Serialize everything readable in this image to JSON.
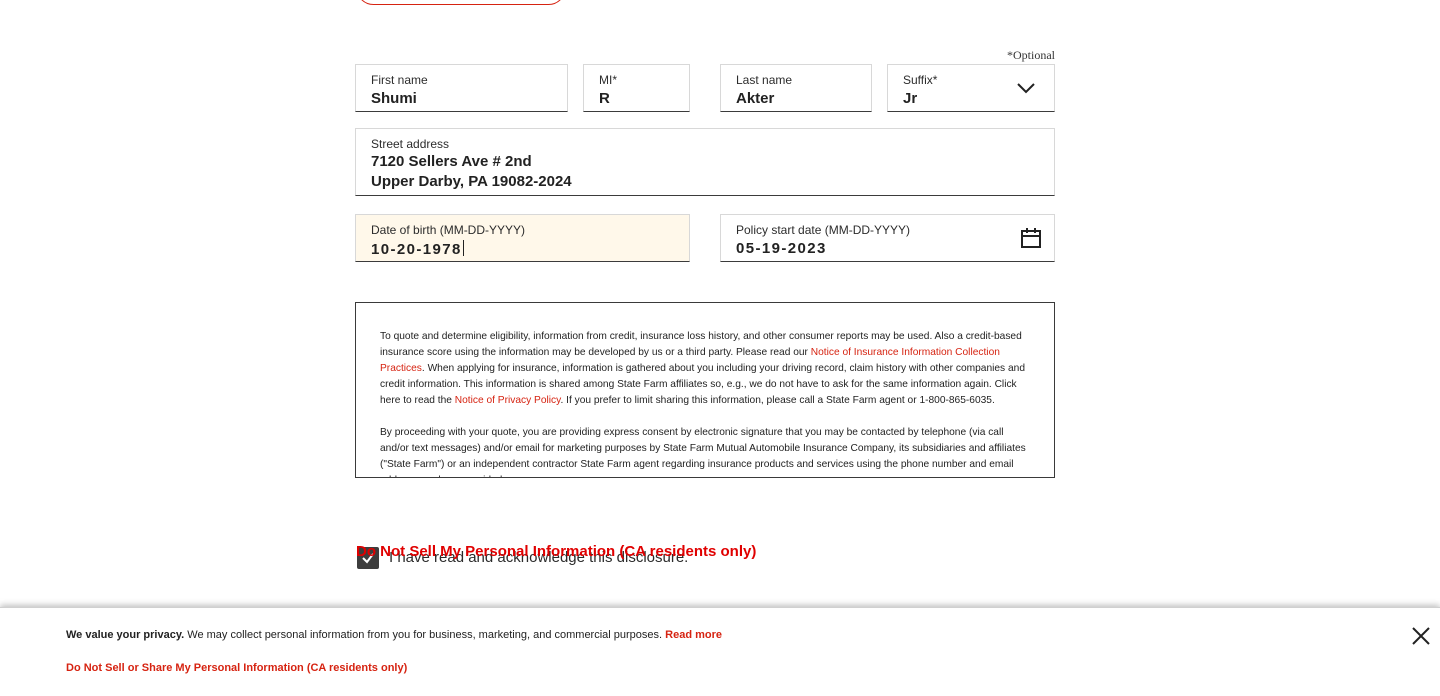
{
  "form": {
    "optional_note": "*Optional",
    "first_name": {
      "label": "First name",
      "value": "Shumi"
    },
    "mi": {
      "label": "MI*",
      "value": "R"
    },
    "last_name": {
      "label": "Last name",
      "value": "Akter"
    },
    "suffix": {
      "label": "Suffix*",
      "value": "Jr"
    },
    "street": {
      "label": "Street address",
      "line1": "7120 Sellers Ave # 2nd",
      "line2": "Upper Darby, PA 19082-2024"
    },
    "dob": {
      "label": "Date of birth (MM-DD-YYYY)",
      "value": "10-20-1978"
    },
    "policy_start": {
      "label": "Policy start date (MM-DD-YYYY)",
      "value": "05-19-2023"
    }
  },
  "disclosure": {
    "p1_a": "To quote and determine eligibility, information from credit, insurance loss history, and other consumer reports may be used. Also a credit-based insurance score using the information may be developed by us or a third party. Please read our ",
    "p1_link1": "Notice of Insurance Information Collection Practices",
    "p1_b": ". When applying for insurance, information is gathered about you including your driving record, claim history with other companies and credit information. This information is shared among State Farm affiliates so, e.g., we do not have to ask for the same information again. Click here to read the ",
    "p1_link2": "Notice of Privacy Policy",
    "p1_c": ". If you prefer to limit sharing this information, please call a State Farm agent or 1-800-865-6035.",
    "p2": "By proceeding with your quote, you are providing express consent by electronic signature that you may be contacted by telephone (via call and/or text messages) and/or email for marketing purposes by State Farm Mutual Automobile Insurance Company, its subsidiaries and affiliates (\"State Farm\") or an independent contractor State Farm agent regarding insurance products and services using the phone number and email address you have provided."
  },
  "acknowledge": {
    "label": "I have read and acknowledge this disclosure.",
    "checked": true
  },
  "do_not_sell_link": "Do Not Sell My Personal Information (CA residents only)",
  "privacy_banner": {
    "bold": "We value your privacy.",
    "text": " We may collect personal information from you for business, marketing, and commercial purposes. ",
    "read_more": "Read more",
    "do_not_sell": "Do Not Sell or Share My Personal Information (CA residents only)"
  },
  "colors": {
    "accent": "#d62311",
    "active_field_bg": "#fff8ea"
  }
}
